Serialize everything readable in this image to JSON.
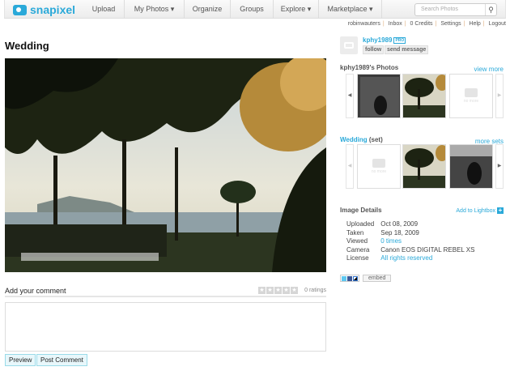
{
  "nav": {
    "logo": "snapixel",
    "items": [
      "Upload",
      "My Photos ▾",
      "Organize",
      "Groups",
      "Explore ▾",
      "Marketplace ▾"
    ],
    "search_placeholder": "Search Photos"
  },
  "userlinks": [
    "robinwauters",
    "Inbox",
    "0 Credits",
    "Settings",
    "Help",
    "Logout"
  ],
  "photo": {
    "title": "Wedding"
  },
  "comment": {
    "heading": "Add your comment",
    "ratings": "0 ratings",
    "rating_value": 0,
    "preview": "Preview",
    "post": "Post Comment"
  },
  "owner": {
    "name": "kphy1989",
    "badge": "PRO",
    "follow": "follow",
    "message": "send message"
  },
  "photostream": {
    "title": "kphy1989's Photos",
    "more": "view more",
    "no_more": "no more"
  },
  "set": {
    "name": "Wedding",
    "suffix": " (set)",
    "more": "more sets",
    "no_more": "no more"
  },
  "details": {
    "title": "Image Details",
    "lightbox": "Add to Lightbox",
    "rows": [
      {
        "label": "Uploaded",
        "value": "Oct 08, 2009"
      },
      {
        "label": "Taken",
        "value": "Sep 18, 2009"
      },
      {
        "label": "Viewed",
        "value": "0 times"
      },
      {
        "label": "Camera",
        "value": "Canon EOS DIGITAL REBEL XS"
      },
      {
        "label": "License",
        "value": "All rights reserved"
      }
    ]
  },
  "share": {
    "embed": "embed"
  },
  "colors": {
    "accent": "#2aa9d9"
  }
}
